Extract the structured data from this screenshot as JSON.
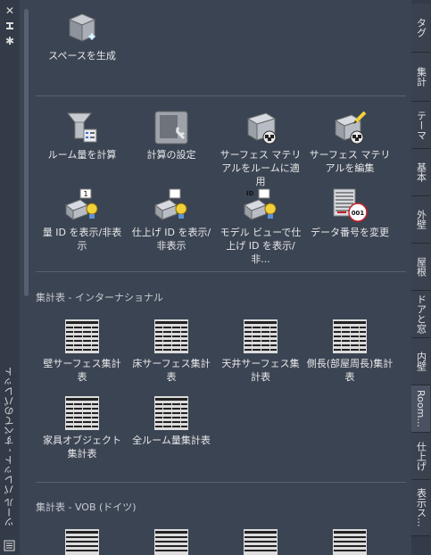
{
  "palette_title": "ツール パレット - すべてのパレット",
  "title_buttons": {
    "close": "✕",
    "autohide": "⇄",
    "properties": "✱"
  },
  "tools": {
    "generate_space": "スペースを生成",
    "calc_room_area": "ルーム量を計算",
    "calc_settings": "計算の設定",
    "apply_surface_material": "サーフェス マテリアルをルームに適用",
    "edit_surface_material": "サーフェス マテリアルを編集",
    "show_hide_qty_id": "量 ID を表示/非表示",
    "show_hide_finish_id": "仕上げ ID を表示/非表示",
    "show_hide_model_finish_id": "モデル ビューで仕上げ ID を表示/非...",
    "change_data_number": "データ番号を変更",
    "wall_surface_schedule": "壁サーフェス集計表",
    "floor_surface_schedule": "床サーフェス集計表",
    "ceiling_surface_schedule": "天井サーフェス集計表",
    "perimeter_schedule": "側長(部屋周長)集計表",
    "furniture_object_schedule": "家具オブジェクト集計表",
    "all_room_qty_schedule": "全ルーム量集計表"
  },
  "sections": {
    "international": "集計表 - インターナショナル",
    "vob": "集計表 - VOB (ドイツ)"
  },
  "icon_badges": {
    "qty_id": "1",
    "data_number": "001",
    "model_id": "ID"
  },
  "tabs": [
    "タグ",
    "集計",
    "テーマ",
    "基本",
    "外壁",
    "屋根",
    "ドアと窓",
    "内壁",
    "Room...",
    "仕上げ",
    "表示ス..."
  ],
  "active_tab": "Room...",
  "colors": {
    "background": "#3b4453",
    "tab_strip": "#333b48",
    "accent_yellow": "#f2d03a",
    "accent_red": "#c8202a"
  }
}
